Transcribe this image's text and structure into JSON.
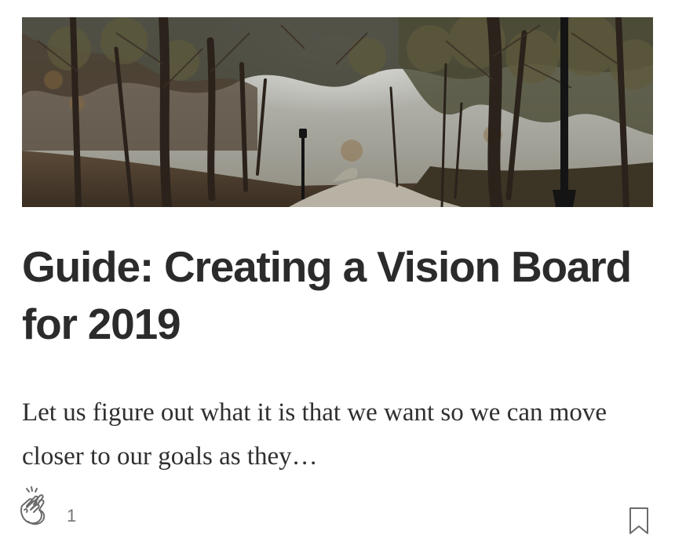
{
  "post": {
    "title": "Guide: Creating a Vision Board for 2019",
    "excerpt": "Let us figure out what it is that we want so we can move closer to our goals as they…",
    "hero_image": "park-path-trees-photo"
  },
  "footer": {
    "clap_icon": "clap-icon",
    "clap_count": "1",
    "bookmark_icon": "bookmark-icon"
  },
  "colors": {
    "title": "#2b2b2b",
    "excerpt": "#2f2f2f",
    "icon": "#6b6b6b",
    "count": "#757575"
  }
}
